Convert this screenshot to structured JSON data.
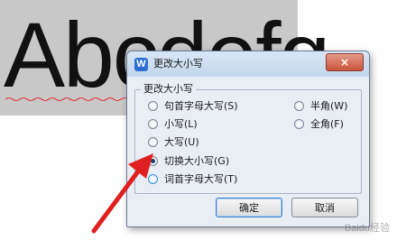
{
  "document": {
    "text": "Abcdefg"
  },
  "dialog": {
    "title": "更改大小写",
    "close": "×",
    "group_label": "更改大小写",
    "options": [
      {
        "label": "句首字母大写(S)",
        "selected": false
      },
      {
        "label": "小写(L)",
        "selected": false
      },
      {
        "label": "大写(U)",
        "selected": false
      },
      {
        "label": "切换大小写(G)",
        "selected": true
      },
      {
        "label": "词首字母大写(T)",
        "selected": false
      },
      {
        "label": "半角(W)",
        "selected": false
      },
      {
        "label": "全角(F)",
        "selected": false
      }
    ],
    "ok_label": "确定",
    "cancel_label": "取消"
  },
  "watermark": "Baidu经验",
  "colors": {
    "arrow": "#e02020",
    "accent": "#3c7fc9"
  }
}
